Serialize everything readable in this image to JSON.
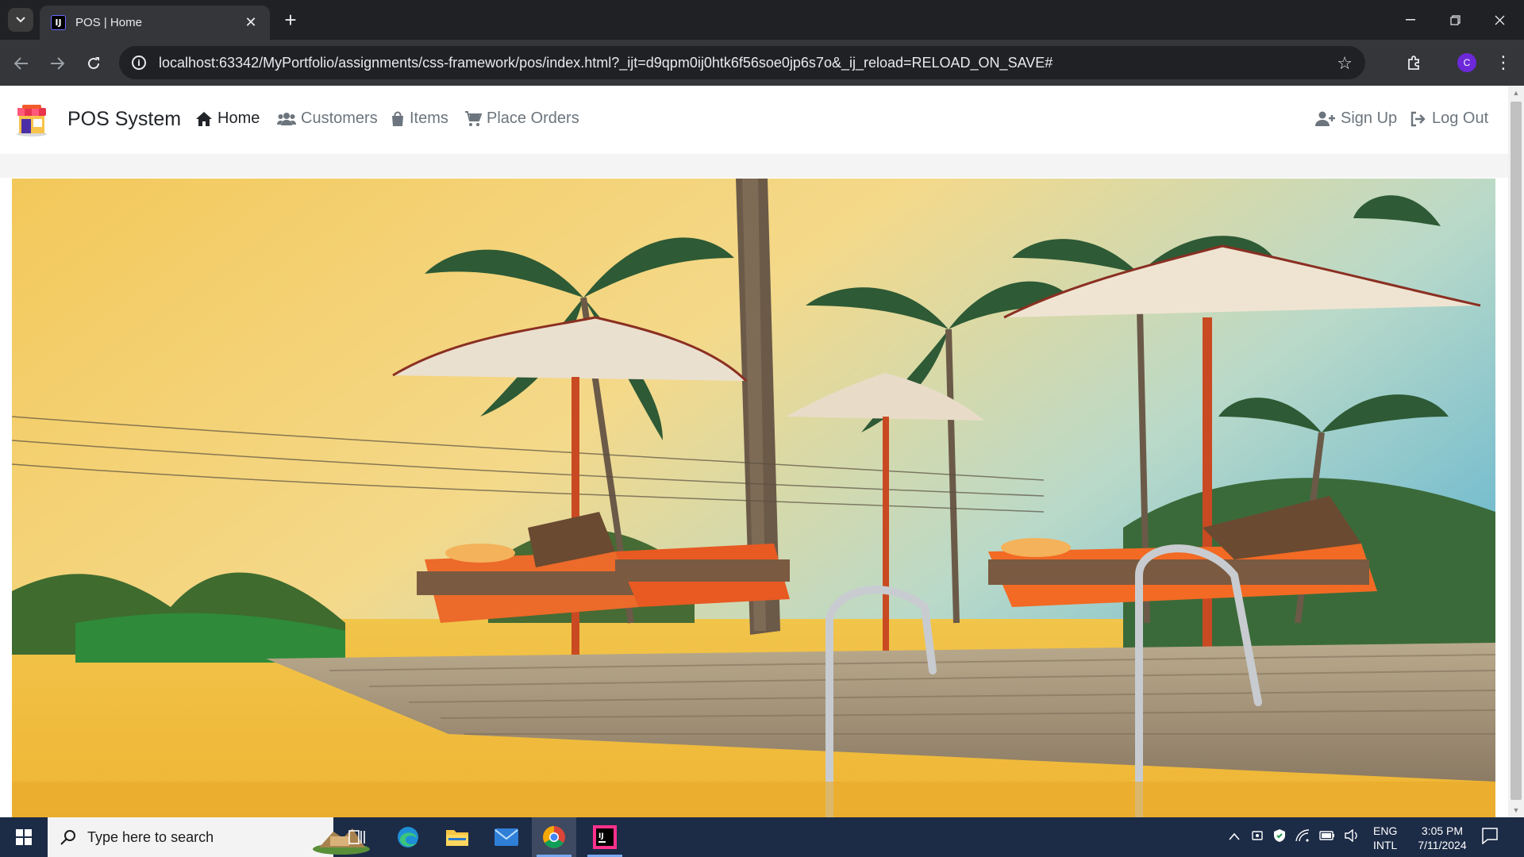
{
  "browser": {
    "tab": {
      "title": "POS | Home",
      "favicon_text": "IJ"
    },
    "url": "localhost:63342/MyPortfolio/assignments/css-framework/pos/index.html?_ijt=d9qpm0ij0htk6f56soe0jp6s7o&_ij_reload=RELOAD_ON_SAVE#",
    "profile_initial": "C",
    "icons": [
      "tab-search-icon",
      "close-icon",
      "plus-icon",
      "minimize-icon",
      "restore-icon",
      "window-close-icon",
      "back-icon",
      "forward-icon",
      "reload-icon",
      "info-icon",
      "star-icon",
      "extensions-icon",
      "menu-icon"
    ]
  },
  "page": {
    "brand": "POS System",
    "nav": [
      {
        "label": "Home",
        "icon": "home-icon",
        "active": true
      },
      {
        "label": "Customers",
        "icon": "users-icon",
        "active": false
      },
      {
        "label": "Items",
        "icon": "shopping-bag-icon",
        "active": false
      },
      {
        "label": "Place Orders",
        "icon": "cart-icon",
        "active": false
      }
    ],
    "right_nav": [
      {
        "label": "Sign Up",
        "icon": "user-plus-icon"
      },
      {
        "label": "Log Out",
        "icon": "sign-out-icon"
      }
    ],
    "hero": {
      "subject": "resort pool deck with sun loungers, umbrellas and palm trees at sunset"
    },
    "colors": {
      "active_link": "#212529",
      "inactive_link": "#6c757d"
    }
  },
  "taskbar": {
    "search_placeholder": "Type here to search",
    "language": [
      "ENG",
      "INTL"
    ],
    "time": "3:05 PM",
    "date": "7/11/2024",
    "apps": [
      "task-view-icon",
      "edge-icon",
      "file-explorer-icon",
      "mail-icon",
      "chrome-icon",
      "intellij-icon"
    ]
  }
}
